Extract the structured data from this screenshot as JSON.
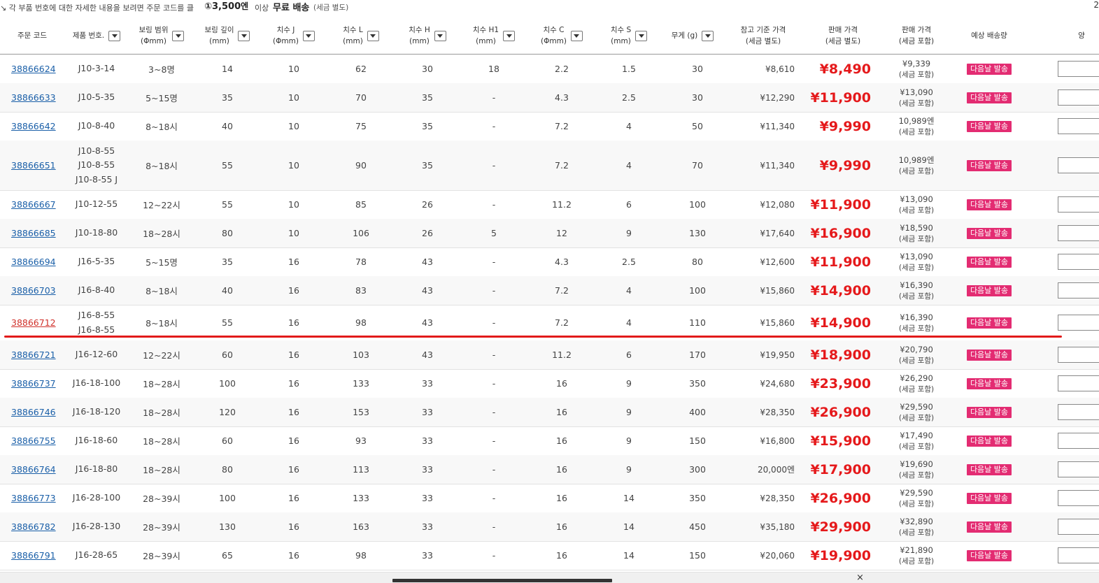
{
  "topbar": {
    "note": "↘ 각 부품 번호에 대한 자세한 내용을 보려면 주문 코드를 클",
    "threshold": "①3,500",
    "threshold_unit": "엔",
    "above": "이상",
    "free_shipping": "무료 배송",
    "tax_note": "(세금 별도)",
    "page_num": "2"
  },
  "headers": {
    "order_code": "주문 코드",
    "product_no": "제품 번호.",
    "boring_range": [
      "보링 범위",
      "(Φmm)"
    ],
    "boring_depth": [
      "보링 깊이",
      "(mm)"
    ],
    "dim_j": [
      "치수 J",
      "(Φmm)"
    ],
    "dim_l": [
      "치수 L",
      "(mm)"
    ],
    "dim_h": [
      "치수 H",
      "(mm)"
    ],
    "dim_h1": [
      "치수 H1",
      "(mm)"
    ],
    "dim_c": [
      "치수 C",
      "(Φmm)"
    ],
    "dim_s": [
      "치수 S",
      "(mm)"
    ],
    "weight": "무게 (g)",
    "ref_price": [
      "참고 기준 가격",
      "(세금 별도)"
    ],
    "sale_price": [
      "판매 가격",
      "(세금 별도)"
    ],
    "sale_price_tax": [
      "판매 가격",
      "(세금 포함)"
    ],
    "ship": "예상 배송량",
    "qty": "양"
  },
  "ship_label": "다음날 발송",
  "rows": [
    {
      "code": "38866624",
      "product": [
        "J10-3-14"
      ],
      "range": "3~8명",
      "depth": "14",
      "j": "10",
      "l": "62",
      "h": "30",
      "h1": "18",
      "c": "2.2",
      "s": "1.5",
      "weight": "30",
      "ref": "¥8,610",
      "price": "¥8,490",
      "taxin": "¥9,339",
      "taxnote": "(세금 포함)"
    },
    {
      "code": "38866633",
      "product": [
        "J10-5-35"
      ],
      "range": "5~15명",
      "depth": "35",
      "j": "10",
      "l": "70",
      "h": "35",
      "h1": "-",
      "c": "4.3",
      "s": "2.5",
      "weight": "30",
      "ref": "¥12,290",
      "price": "¥11,900",
      "taxin": "¥13,090",
      "taxnote": "(세금 포함)"
    },
    {
      "code": "38866642",
      "product": [
        "J10-8-40"
      ],
      "range": "8~18시",
      "depth": "40",
      "j": "10",
      "l": "75",
      "h": "35",
      "h1": "-",
      "c": "7.2",
      "s": "4",
      "weight": "50",
      "ref": "¥11,340",
      "price": "¥9,990",
      "taxin": "10,989엔",
      "taxnote": "(세금 포함)"
    },
    {
      "code": "38866651",
      "product": [
        "J10-8-55",
        "J10-8-55",
        "J10-8-55 J"
      ],
      "range": "8~18시",
      "depth": "55",
      "j": "10",
      "l": "90",
      "h": "35",
      "h1": "-",
      "c": "7.2",
      "s": "4",
      "weight": "70",
      "ref": "¥11,340",
      "price": "¥9,990",
      "taxin": "10,989엔",
      "taxnote": "(세금 포함)"
    },
    {
      "code": "38866667",
      "product": [
        "J10-12-55"
      ],
      "range": "12~22시",
      "depth": "55",
      "j": "10",
      "l": "85",
      "h": "26",
      "h1": "-",
      "c": "11.2",
      "s": "6",
      "weight": "100",
      "ref": "¥12,080",
      "price": "¥11,900",
      "taxin": "¥13,090",
      "taxnote": "(세금 포함)"
    },
    {
      "code": "38866685",
      "product": [
        "J10-18-80"
      ],
      "range": "18~28시",
      "depth": "80",
      "j": "10",
      "l": "106",
      "h": "26",
      "h1": "5",
      "c": "12",
      "s": "9",
      "weight": "130",
      "ref": "¥17,640",
      "price": "¥16,900",
      "taxin": "¥18,590",
      "taxnote": "(세금 포함)"
    },
    {
      "code": "38866694",
      "product": [
        "J16-5-35"
      ],
      "range": "5~15명",
      "depth": "35",
      "j": "16",
      "l": "78",
      "h": "43",
      "h1": "-",
      "c": "4.3",
      "s": "2.5",
      "weight": "80",
      "ref": "¥12,600",
      "price": "¥11,900",
      "taxin": "¥13,090",
      "taxnote": "(세금 포함)"
    },
    {
      "code": "38866703",
      "product": [
        "J16-8-40"
      ],
      "range": "8~18시",
      "depth": "40",
      "j": "16",
      "l": "83",
      "h": "43",
      "h1": "-",
      "c": "7.2",
      "s": "4",
      "weight": "100",
      "ref": "¥15,860",
      "price": "¥14,900",
      "taxin": "¥16,390",
      "taxnote": "(세금 포함)"
    },
    {
      "code": "38866712",
      "product": [
        "J16-8-55",
        "J16-8-55"
      ],
      "range": "8~18시",
      "depth": "55",
      "j": "16",
      "l": "98",
      "h": "43",
      "h1": "-",
      "c": "7.2",
      "s": "4",
      "weight": "110",
      "ref": "¥15,860",
      "price": "¥14,900",
      "taxin": "¥16,390",
      "taxnote": "(세금 포함)",
      "selected": true
    },
    {
      "code": "38866721",
      "product": [
        "J16-12-60"
      ],
      "range": "12~22시",
      "depth": "60",
      "j": "16",
      "l": "103",
      "h": "43",
      "h1": "-",
      "c": "11.2",
      "s": "6",
      "weight": "170",
      "ref": "¥19,950",
      "price": "¥18,900",
      "taxin": "¥20,790",
      "taxnote": "(세금 포함)"
    },
    {
      "code": "38866737",
      "product": [
        "J16-18-100"
      ],
      "range": "18~28시",
      "depth": "100",
      "j": "16",
      "l": "133",
      "h": "33",
      "h1": "-",
      "c": "16",
      "s": "9",
      "weight": "350",
      "ref": "¥24,680",
      "price": "¥23,900",
      "taxin": "¥26,290",
      "taxnote": "(세금 포함)"
    },
    {
      "code": "38866746",
      "product": [
        "J16-18-120"
      ],
      "range": "18~28시",
      "depth": "120",
      "j": "16",
      "l": "153",
      "h": "33",
      "h1": "-",
      "c": "16",
      "s": "9",
      "weight": "400",
      "ref": "¥28,350",
      "price": "¥26,900",
      "taxin": "¥29,590",
      "taxnote": "(세금 포함)"
    },
    {
      "code": "38866755",
      "product": [
        "J16-18-60"
      ],
      "range": "18~28시",
      "depth": "60",
      "j": "16",
      "l": "93",
      "h": "33",
      "h1": "-",
      "c": "16",
      "s": "9",
      "weight": "150",
      "ref": "¥16,800",
      "price": "¥15,900",
      "taxin": "¥17,490",
      "taxnote": "(세금 포함)"
    },
    {
      "code": "38866764",
      "product": [
        "J16-18-80"
      ],
      "range": "18~28시",
      "depth": "80",
      "j": "16",
      "l": "113",
      "h": "33",
      "h1": "-",
      "c": "16",
      "s": "9",
      "weight": "300",
      "ref": "20,000엔",
      "price": "¥17,900",
      "taxin": "¥19,690",
      "taxnote": "(세금 포함)"
    },
    {
      "code": "38866773",
      "product": [
        "J16-28-100"
      ],
      "range": "28~39시",
      "depth": "100",
      "j": "16",
      "l": "133",
      "h": "33",
      "h1": "-",
      "c": "16",
      "s": "14",
      "weight": "350",
      "ref": "¥28,350",
      "price": "¥26,900",
      "taxin": "¥29,590",
      "taxnote": "(세금 포함)"
    },
    {
      "code": "38866782",
      "product": [
        "J16-28-130"
      ],
      "range": "28~39시",
      "depth": "130",
      "j": "16",
      "l": "163",
      "h": "33",
      "h1": "-",
      "c": "16",
      "s": "14",
      "weight": "450",
      "ref": "¥35,180",
      "price": "¥29,900",
      "taxin": "¥32,890",
      "taxnote": "(세금 포함)"
    },
    {
      "code": "38866791",
      "product": [
        "J16-28-65"
      ],
      "range": "28~39시",
      "depth": "65",
      "j": "16",
      "l": "98",
      "h": "33",
      "h1": "-",
      "c": "16",
      "s": "14",
      "weight": "150",
      "ref": "¥20,060",
      "price": "¥19,900",
      "taxin": "¥21,890",
      "taxnote": "(세금 포함)"
    }
  ],
  "footer": {
    "close_glyph": "×"
  },
  "colors": {
    "price_red": "#e5191b",
    "badge_pink": "#e32c72",
    "link_blue": "#1a5fa8",
    "selected_line": "#e21a1a"
  }
}
